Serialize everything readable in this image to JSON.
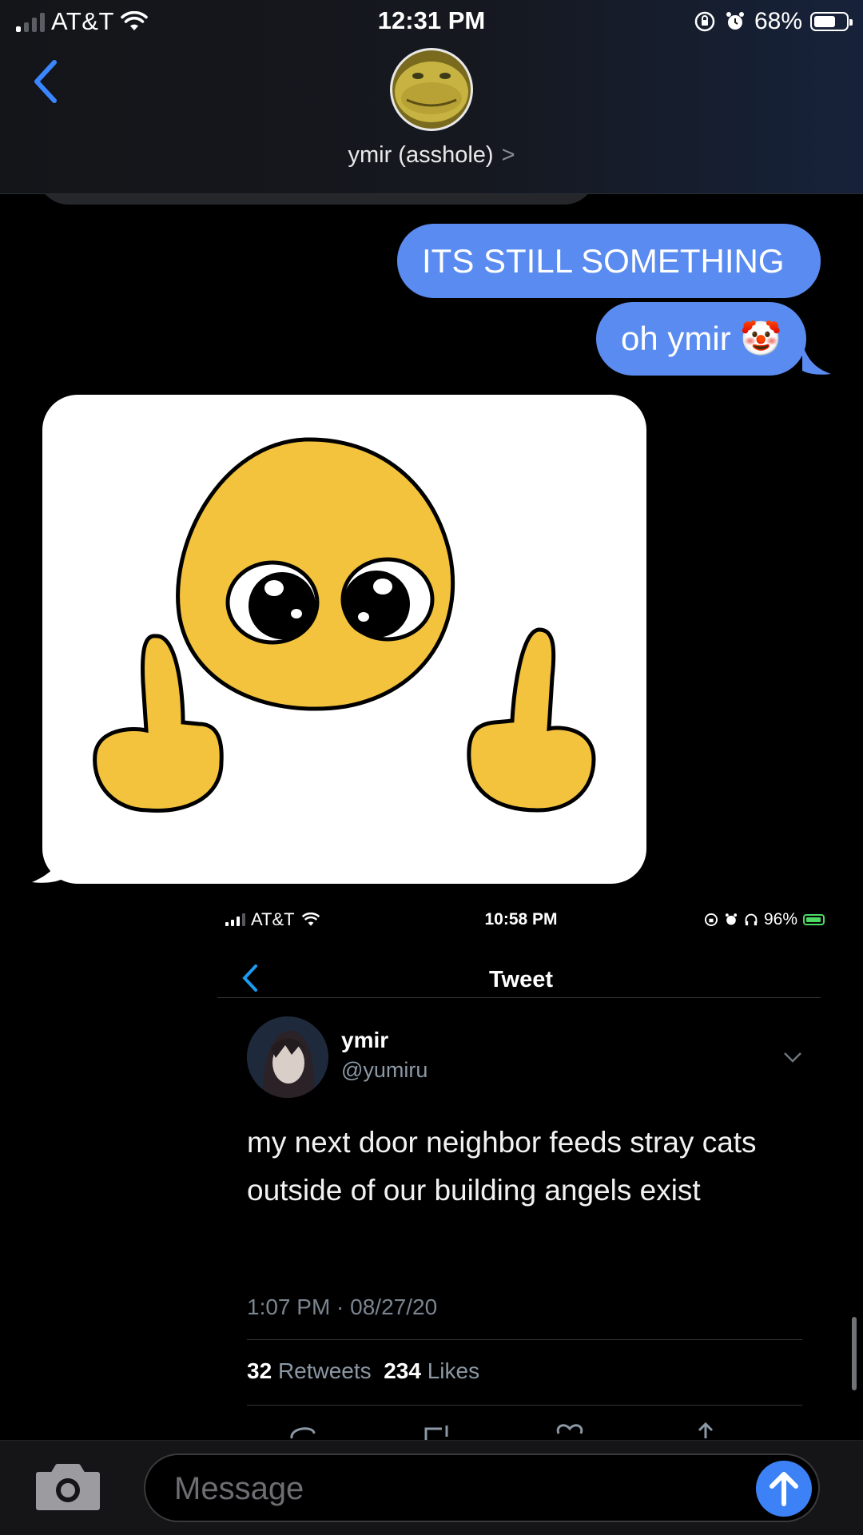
{
  "status_bar": {
    "carrier": "AT&T",
    "time": "12:31 PM",
    "battery_percent": "68%",
    "battery_level": 0.68,
    "icons": [
      "signal-icon",
      "wifi-icon",
      "orientation-lock-icon",
      "alarm-icon",
      "battery-icon"
    ]
  },
  "header": {
    "back_icon": "chevron-left-icon",
    "contact_name": "ymir (asshole)",
    "contact_chevron": ">"
  },
  "messages": [
    {
      "direction": "outgoing",
      "text": "ITS STILL SOMETHING"
    },
    {
      "direction": "outgoing",
      "text": "oh ymir 🤡"
    },
    {
      "direction": "incoming",
      "type": "image",
      "image": "pleading-face-middle-fingers-sticker"
    },
    {
      "direction": "incoming",
      "type": "image",
      "image": "tweet-screenshot"
    }
  ],
  "tweet_screenshot": {
    "status_bar": {
      "carrier": "AT&T",
      "time": "10:58 PM",
      "battery_percent": "96%"
    },
    "nav_title": "Tweet",
    "author_name": "ymir",
    "author_handle": "@yumiru",
    "text": "my next door neighbor feeds stray cats outside of our building angels exist",
    "timestamp": "1:07 PM · 08/27/20",
    "retweets_count": "32",
    "retweets_label": "Retweets",
    "likes_count": "234",
    "likes_label": "Likes"
  },
  "compose": {
    "placeholder": "Message",
    "camera_icon": "camera-icon",
    "send_icon": "arrow-up-icon"
  },
  "colors": {
    "outgoing_bubble": "#5a8bf0",
    "ios_blue": "#3c82f6",
    "background": "#000000"
  }
}
